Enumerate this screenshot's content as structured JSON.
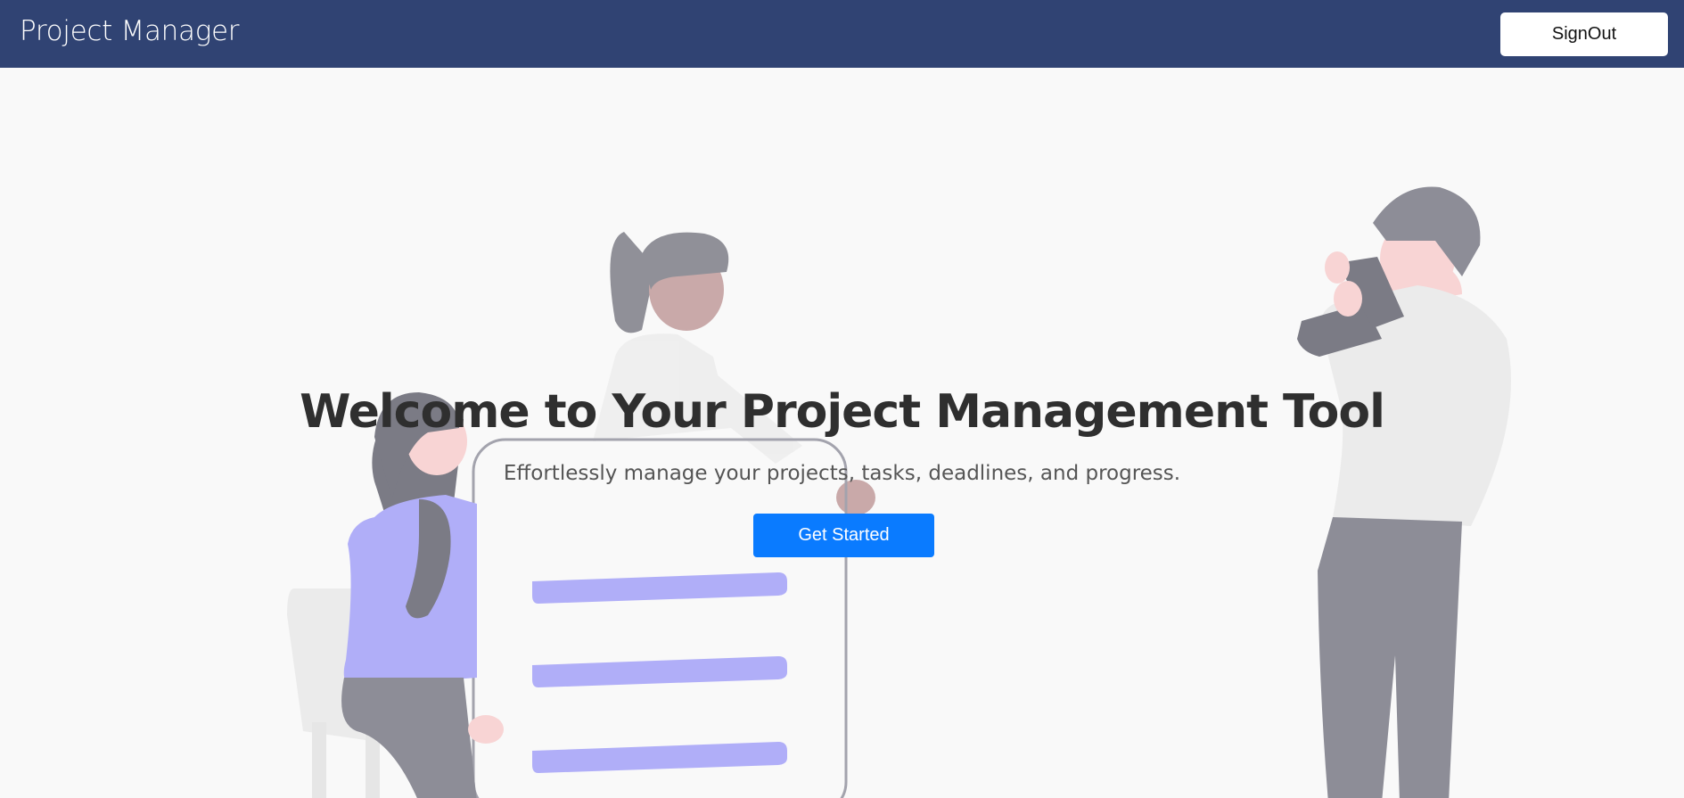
{
  "navbar": {
    "brand": "Project Manager",
    "signout_label": "SignOut",
    "background_color": "#304373"
  },
  "hero": {
    "title": "Welcome to Your Project Management Tool",
    "subtitle": "Effortlessly manage your projects, tasks, deadlines, and progress.",
    "cta_label": "Get Started",
    "cta_color": "#0a7bff",
    "illustration_name": "team-task-board-illustration"
  }
}
